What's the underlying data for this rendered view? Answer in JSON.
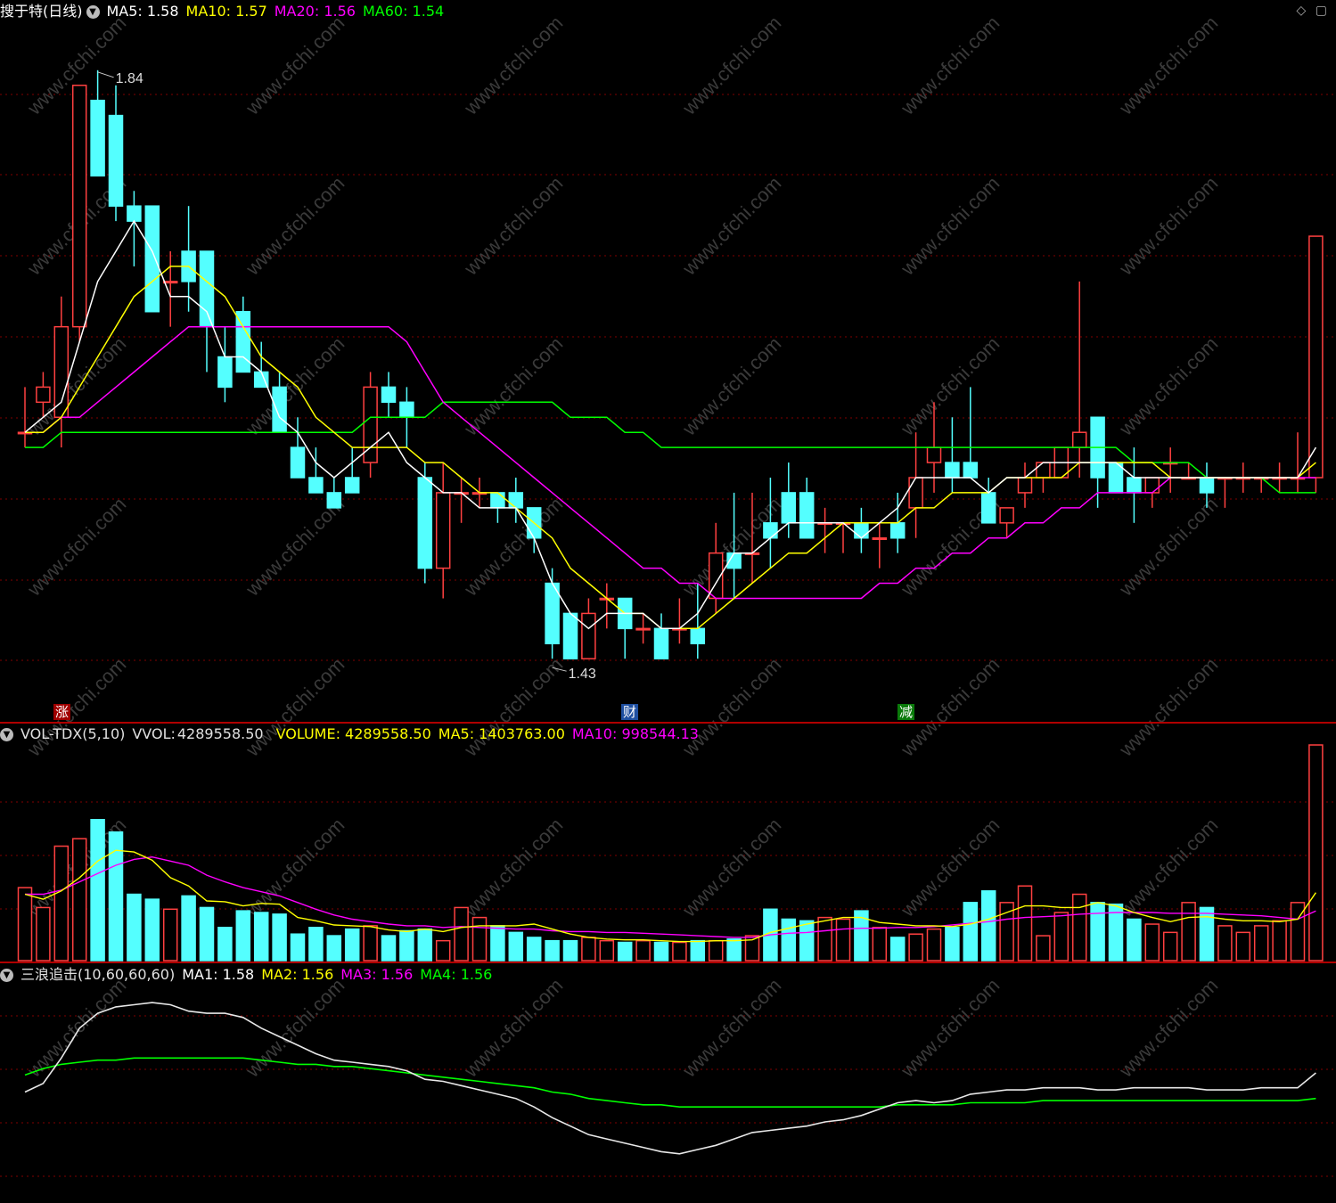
{
  "colors": {
    "background": "#000000",
    "up": "#ff4040",
    "down": "#54ffff",
    "grid": "#800000",
    "ma5": "#ffffff",
    "ma10": "#ffff00",
    "ma20": "#ff00ff",
    "ma60": "#00ff00",
    "divider": "#b00000"
  },
  "price_panel": {
    "title": "搜于特(日线)",
    "icon": "chevron-down-icon",
    "legend": [
      {
        "label": "MA5:",
        "value": "1.58",
        "color": "#ffffff"
      },
      {
        "label": "MA10:",
        "value": "1.57",
        "color": "#ffff00"
      },
      {
        "label": "MA20:",
        "value": "1.56",
        "color": "#ff00ff"
      },
      {
        "label": "MA60:",
        "value": "1.54",
        "color": "#00ff00"
      }
    ],
    "high_label": "1.84",
    "low_label": "1.43",
    "markers": [
      {
        "text": "涨",
        "bg": "#a00000"
      },
      {
        "text": "财",
        "bg": "#1f4fa0"
      },
      {
        "text": "减",
        "bg": "#0a7a0a"
      }
    ],
    "corner_icons": [
      "diamond-icon",
      "square-icon"
    ]
  },
  "volume_panel": {
    "title": "VOL-TDX(5,10)",
    "vvol_label": "VVOL:",
    "vvol_value": "4289558.50",
    "legend": [
      {
        "label": "VOLUME:",
        "value": "4289558.50",
        "color": "#ffff00"
      },
      {
        "label": "MA5:",
        "value": "1403763.00",
        "color": "#ffff00"
      },
      {
        "label": "MA10:",
        "value": "998544.13",
        "color": "#ff00ff"
      }
    ]
  },
  "wave_panel": {
    "title": "三浪追击(10,60,60,60)",
    "legend": [
      {
        "label": "MA1:",
        "value": "1.58",
        "color": "#ffffff"
      },
      {
        "label": "MA2:",
        "value": "1.56",
        "color": "#ffff00"
      },
      {
        "label": "MA3:",
        "value": "1.56",
        "color": "#ff00ff"
      },
      {
        "label": "MA4:",
        "value": "1.56",
        "color": "#00ff00"
      }
    ]
  },
  "watermark": "www.cfchi.com",
  "chart_data": [
    {
      "type": "candlestick",
      "panel": "price",
      "ylim": [
        1.41,
        1.86
      ],
      "grid": true,
      "candles": [
        [
          1.59,
          1.62,
          1.58,
          1.59
        ],
        [
          1.61,
          1.63,
          1.6,
          1.62
        ],
        [
          1.6,
          1.68,
          1.58,
          1.66
        ],
        [
          1.66,
          1.81,
          1.65,
          1.82
        ],
        [
          1.81,
          1.83,
          1.77,
          1.76
        ],
        [
          1.8,
          1.82,
          1.73,
          1.74
        ],
        [
          1.74,
          1.75,
          1.7,
          1.73
        ],
        [
          1.74,
          1.73,
          1.67,
          1.67
        ],
        [
          1.69,
          1.71,
          1.66,
          1.69
        ],
        [
          1.71,
          1.74,
          1.67,
          1.69
        ],
        [
          1.71,
          1.7,
          1.63,
          1.66
        ],
        [
          1.64,
          1.66,
          1.61,
          1.62
        ],
        [
          1.67,
          1.68,
          1.63,
          1.63
        ],
        [
          1.63,
          1.65,
          1.62,
          1.62
        ],
        [
          1.62,
          1.63,
          1.59,
          1.59
        ],
        [
          1.58,
          1.6,
          1.57,
          1.56
        ],
        [
          1.56,
          1.58,
          1.55,
          1.55
        ],
        [
          1.55,
          1.56,
          1.54,
          1.54
        ],
        [
          1.56,
          1.58,
          1.55,
          1.55
        ],
        [
          1.57,
          1.63,
          1.56,
          1.62
        ],
        [
          1.62,
          1.63,
          1.6,
          1.61
        ],
        [
          1.61,
          1.62,
          1.58,
          1.6
        ],
        [
          1.56,
          1.57,
          1.49,
          1.5
        ],
        [
          1.5,
          1.57,
          1.48,
          1.55
        ],
        [
          1.55,
          1.56,
          1.53,
          1.55
        ],
        [
          1.55,
          1.56,
          1.54,
          1.55
        ],
        [
          1.55,
          1.55,
          1.53,
          1.54
        ],
        [
          1.55,
          1.56,
          1.53,
          1.54
        ],
        [
          1.54,
          1.53,
          1.51,
          1.52
        ],
        [
          1.49,
          1.5,
          1.44,
          1.45
        ],
        [
          1.47,
          1.47,
          1.44,
          1.44
        ],
        [
          1.44,
          1.48,
          1.44,
          1.47
        ],
        [
          1.48,
          1.49,
          1.46,
          1.48
        ],
        [
          1.48,
          1.48,
          1.44,
          1.46
        ],
        [
          1.46,
          1.47,
          1.45,
          1.46
        ],
        [
          1.46,
          1.47,
          1.44,
          1.44
        ],
        [
          1.46,
          1.48,
          1.45,
          1.46
        ],
        [
          1.46,
          1.49,
          1.44,
          1.45
        ],
        [
          1.48,
          1.53,
          1.47,
          1.51
        ],
        [
          1.51,
          1.55,
          1.48,
          1.5
        ],
        [
          1.51,
          1.55,
          1.49,
          1.51
        ],
        [
          1.53,
          1.56,
          1.5,
          1.52
        ],
        [
          1.55,
          1.57,
          1.52,
          1.53
        ],
        [
          1.55,
          1.56,
          1.53,
          1.52
        ],
        [
          1.53,
          1.54,
          1.51,
          1.53
        ],
        [
          1.53,
          1.53,
          1.51,
          1.53
        ],
        [
          1.53,
          1.54,
          1.51,
          1.52
        ],
        [
          1.52,
          1.53,
          1.5,
          1.52
        ],
        [
          1.53,
          1.55,
          1.51,
          1.52
        ],
        [
          1.54,
          1.59,
          1.52,
          1.56
        ],
        [
          1.57,
          1.61,
          1.55,
          1.58
        ],
        [
          1.57,
          1.6,
          1.55,
          1.56
        ],
        [
          1.57,
          1.62,
          1.56,
          1.56
        ],
        [
          1.55,
          1.56,
          1.53,
          1.53
        ],
        [
          1.53,
          1.54,
          1.52,
          1.54
        ],
        [
          1.55,
          1.57,
          1.54,
          1.56
        ],
        [
          1.56,
          1.57,
          1.55,
          1.57
        ],
        [
          1.56,
          1.58,
          1.56,
          1.58
        ],
        [
          1.58,
          1.69,
          1.56,
          1.59
        ],
        [
          1.6,
          1.6,
          1.54,
          1.56
        ],
        [
          1.57,
          1.57,
          1.55,
          1.55
        ],
        [
          1.56,
          1.58,
          1.53,
          1.55
        ],
        [
          1.55,
          1.56,
          1.54,
          1.56
        ],
        [
          1.57,
          1.58,
          1.55,
          1.57
        ],
        [
          1.56,
          1.57,
          1.56,
          1.56
        ],
        [
          1.56,
          1.57,
          1.54,
          1.55
        ],
        [
          1.56,
          1.56,
          1.54,
          1.56
        ],
        [
          1.56,
          1.57,
          1.55,
          1.56
        ],
        [
          1.56,
          1.56,
          1.55,
          1.56
        ],
        [
          1.56,
          1.57,
          1.55,
          1.56
        ],
        [
          1.56,
          1.59,
          1.55,
          1.56
        ],
        [
          1.56,
          1.72,
          1.55,
          1.72
        ]
      ],
      "ma5": [
        1.59,
        1.6,
        1.61,
        1.65,
        1.69,
        1.71,
        1.73,
        1.71,
        1.68,
        1.68,
        1.67,
        1.64,
        1.64,
        1.63,
        1.6,
        1.59,
        1.57,
        1.56,
        1.57,
        1.58,
        1.59,
        1.57,
        1.56,
        1.55,
        1.55,
        1.54,
        1.54,
        1.54,
        1.52,
        1.49,
        1.47,
        1.46,
        1.47,
        1.47,
        1.47,
        1.46,
        1.46,
        1.47,
        1.49,
        1.51,
        1.51,
        1.52,
        1.53,
        1.53,
        1.53,
        1.53,
        1.52,
        1.53,
        1.54,
        1.56,
        1.56,
        1.56,
        1.56,
        1.55,
        1.56,
        1.56,
        1.57,
        1.57,
        1.57,
        1.57,
        1.57,
        1.56,
        1.56,
        1.56,
        1.56,
        1.56,
        1.56,
        1.56,
        1.56,
        1.56,
        1.56,
        1.58
      ],
      "ma10": [
        1.59,
        1.59,
        1.6,
        1.62,
        1.64,
        1.66,
        1.68,
        1.69,
        1.7,
        1.7,
        1.69,
        1.68,
        1.66,
        1.64,
        1.63,
        1.62,
        1.6,
        1.59,
        1.58,
        1.58,
        1.58,
        1.58,
        1.57,
        1.57,
        1.56,
        1.55,
        1.55,
        1.54,
        1.53,
        1.52,
        1.5,
        1.49,
        1.48,
        1.47,
        1.47,
        1.46,
        1.46,
        1.46,
        1.47,
        1.48,
        1.49,
        1.5,
        1.51,
        1.51,
        1.52,
        1.53,
        1.53,
        1.53,
        1.53,
        1.54,
        1.54,
        1.55,
        1.55,
        1.55,
        1.56,
        1.56,
        1.56,
        1.56,
        1.57,
        1.57,
        1.57,
        1.57,
        1.57,
        1.56,
        1.56,
        1.56,
        1.56,
        1.56,
        1.56,
        1.56,
        1.56,
        1.57
      ],
      "ma20": [
        1.59,
        1.59,
        1.6,
        1.6,
        1.61,
        1.62,
        1.63,
        1.64,
        1.65,
        1.66,
        1.66,
        1.66,
        1.66,
        1.66,
        1.66,
        1.66,
        1.66,
        1.66,
        1.66,
        1.66,
        1.66,
        1.65,
        1.63,
        1.61,
        1.6,
        1.59,
        1.58,
        1.57,
        1.56,
        1.55,
        1.54,
        1.53,
        1.52,
        1.51,
        1.5,
        1.5,
        1.49,
        1.49,
        1.48,
        1.48,
        1.48,
        1.48,
        1.48,
        1.48,
        1.48,
        1.48,
        1.48,
        1.49,
        1.49,
        1.5,
        1.5,
        1.51,
        1.51,
        1.52,
        1.52,
        1.53,
        1.53,
        1.54,
        1.54,
        1.55,
        1.55,
        1.55,
        1.55,
        1.56,
        1.56,
        1.56,
        1.56,
        1.56,
        1.56,
        1.56,
        1.56,
        1.56
      ],
      "ma60": [
        1.58,
        1.58,
        1.59,
        1.59,
        1.59,
        1.59,
        1.59,
        1.59,
        1.59,
        1.59,
        1.59,
        1.59,
        1.59,
        1.59,
        1.59,
        1.59,
        1.59,
        1.59,
        1.59,
        1.6,
        1.6,
        1.6,
        1.6,
        1.61,
        1.61,
        1.61,
        1.61,
        1.61,
        1.61,
        1.61,
        1.6,
        1.6,
        1.6,
        1.59,
        1.59,
        1.58,
        1.58,
        1.58,
        1.58,
        1.58,
        1.58,
        1.58,
        1.58,
        1.58,
        1.58,
        1.58,
        1.58,
        1.58,
        1.58,
        1.58,
        1.58,
        1.58,
        1.58,
        1.58,
        1.58,
        1.58,
        1.58,
        1.58,
        1.58,
        1.58,
        1.58,
        1.57,
        1.57,
        1.57,
        1.57,
        1.56,
        1.56,
        1.56,
        1.56,
        1.55,
        1.55,
        1.55
      ]
    },
    {
      "type": "bar",
      "panel": "volume",
      "ylim": [
        0,
        260
      ],
      "volumes": [
        88,
        64,
        138,
        147,
        170,
        155,
        80,
        74,
        62,
        78,
        64,
        40,
        60,
        58,
        56,
        32,
        40,
        30,
        38,
        42,
        30,
        36,
        38,
        24,
        64,
        52,
        42,
        34,
        28,
        24,
        24,
        28,
        24,
        22,
        24,
        22,
        22,
        24,
        24,
        26,
        30,
        62,
        50,
        48,
        52,
        50,
        60,
        40,
        28,
        32,
        38,
        40,
        70,
        84,
        70,
        90,
        30,
        58,
        80,
        70,
        68,
        50,
        44,
        34,
        70,
        64,
        42,
        34,
        42,
        48,
        70,
        260
      ],
      "vol_ma5": [
        80,
        74,
        84,
        100,
        120,
        133,
        131,
        121,
        100,
        90,
        72,
        71,
        66,
        69,
        68,
        52,
        48,
        43,
        42,
        41,
        37,
        35,
        38,
        35,
        40,
        42,
        42,
        42,
        44,
        38,
        32,
        28,
        26,
        25,
        25,
        24,
        23,
        23,
        24,
        24,
        25,
        34,
        39,
        44,
        48,
        52,
        52,
        46,
        44,
        42,
        42,
        41,
        44,
        50,
        58,
        66,
        66,
        64,
        64,
        70,
        66,
        58,
        52,
        47,
        52,
        53,
        50,
        48,
        48,
        47,
        50,
        82
      ],
      "vol_ma10": [
        80,
        80,
        85,
        95,
        105,
        115,
        122,
        125,
        120,
        115,
        103,
        95,
        88,
        83,
        78,
        70,
        62,
        55,
        50,
        47,
        44,
        42,
        42,
        40,
        41,
        40,
        39,
        38,
        38,
        36,
        35,
        35,
        34,
        34,
        33,
        32,
        31,
        30,
        29,
        28,
        28,
        31,
        33,
        34,
        36,
        38,
        39,
        39,
        40,
        40,
        41,
        43,
        45,
        47,
        50,
        52,
        53,
        54,
        56,
        57,
        58,
        58,
        58,
        57,
        57,
        57,
        56,
        55,
        54,
        52,
        50,
        60
      ]
    },
    {
      "type": "line",
      "panel": "wave",
      "ylim": [
        0,
        100
      ],
      "ma1": [
        50,
        54,
        66,
        80,
        87,
        90,
        91,
        92,
        91,
        88,
        87,
        87,
        85,
        80,
        76,
        72,
        68,
        65,
        64,
        63,
        62,
        60,
        56,
        55,
        53,
        51,
        49,
        47,
        43,
        38,
        34,
        30,
        28,
        26,
        24,
        22,
        21,
        23,
        25,
        28,
        31,
        32,
        33,
        34,
        36,
        37,
        39,
        42,
        45,
        46,
        45,
        46,
        49,
        50,
        51,
        51,
        52,
        52,
        52,
        51,
        51,
        52,
        52,
        52,
        52,
        51,
        51,
        51,
        52,
        52,
        52,
        59
      ],
      "ma4": [
        58,
        61,
        63,
        64,
        65,
        65,
        66,
        66,
        66,
        66,
        66,
        66,
        66,
        65,
        64,
        63,
        63,
        62,
        62,
        61,
        60,
        59,
        58,
        57,
        56,
        55,
        54,
        53,
        52,
        50,
        49,
        47,
        46,
        45,
        44,
        44,
        43,
        43,
        43,
        43,
        43,
        43,
        43,
        43,
        43,
        43,
        43,
        43,
        44,
        44,
        44,
        44,
        45,
        45,
        45,
        45,
        46,
        46,
        46,
        46,
        46,
        46,
        46,
        46,
        46,
        46,
        46,
        46,
        46,
        46,
        46,
        47
      ]
    }
  ]
}
